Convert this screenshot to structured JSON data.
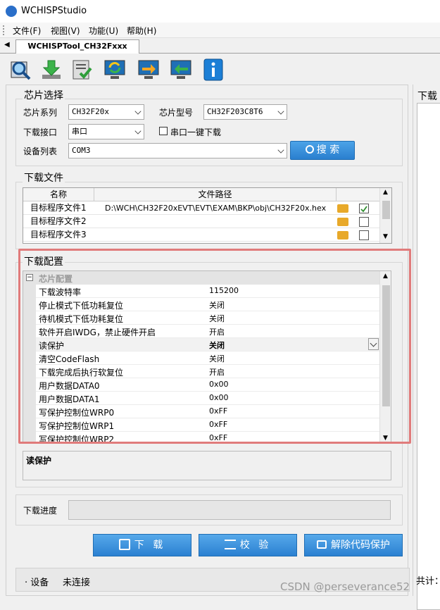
{
  "window": {
    "title": "WCHISPStudio"
  },
  "menu": {
    "items": [
      "文件(F)",
      "视图(V)",
      "功能(U)",
      "帮助(H)"
    ]
  },
  "tabs": {
    "active": "WCHISPTool_CH32Fxxx"
  },
  "toolbar": {
    "icons": [
      "search-chip-icon",
      "download-icon",
      "verify-icon",
      "refresh-icon",
      "export-icon",
      "import-icon",
      "info-icon"
    ]
  },
  "chip_select": {
    "title": "芯片选择",
    "series_label": "芯片系列",
    "series_value": "CH32F20x",
    "model_label": "芯片型号",
    "model_value": "CH32F203C8T6",
    "interface_label": "下载接口",
    "interface_value": "串口",
    "one_key_label": "串口一键下载",
    "device_label": "设备列表",
    "device_value": "COM3",
    "search_button": "搜 索"
  },
  "download_files": {
    "title": "下载文件",
    "headers": [
      "名称",
      "文件路径"
    ],
    "rows": [
      {
        "name": "目标程序文件1",
        "path": "D:\\WCH\\CH32F20xEVT\\EVT\\EXAM\\BKP\\obj\\CH32F20x.hex",
        "checked": true
      },
      {
        "name": "目标程序文件2",
        "path": "",
        "checked": false
      },
      {
        "name": "目标程序文件3",
        "path": "",
        "checked": false
      }
    ]
  },
  "download_config": {
    "title": "下载配置",
    "group": "芯片配置",
    "props": [
      {
        "name": "下载波特率",
        "value": "115200"
      },
      {
        "name": "停止模式下低功耗复位",
        "value": "关闭"
      },
      {
        "name": "待机模式下低功耗复位",
        "value": "关闭"
      },
      {
        "name": "软件开启IWDG，禁止硬件开启",
        "value": "开启"
      },
      {
        "name": "读保护",
        "value": "关闭"
      },
      {
        "name": "清空CodeFlash",
        "value": "关闭"
      },
      {
        "name": "下载完成后执行软复位",
        "value": "开启"
      },
      {
        "name": "用户数据DATA0",
        "value": "0x00"
      },
      {
        "name": "用户数据DATA1",
        "value": "0x00"
      },
      {
        "name": "写保护控制位WRP0",
        "value": "0xFF"
      },
      {
        "name": "写保护控制位WRP1",
        "value": "0xFF"
      },
      {
        "name": "写保护控制位WRP2",
        "value": "0xFF"
      }
    ],
    "description": "读保护"
  },
  "progress": {
    "label": "下载进度",
    "value": 0
  },
  "actions": {
    "download": "下 载",
    "verify": "校 验",
    "unprotect": "解除代码保护"
  },
  "status": {
    "device_label": "· 设备",
    "device_value": "未连接",
    "total_label": "共计："
  },
  "right_panel": {
    "title": "下载"
  },
  "watermark": "CSDN @perseverance52",
  "colors": {
    "highlight_box": "#e07b7b",
    "accent": "#2a7fcf"
  }
}
